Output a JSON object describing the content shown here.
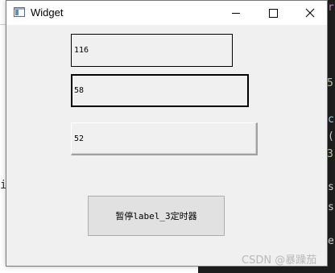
{
  "window": {
    "title": "Widget",
    "icon": "app-window-icon",
    "controls": [
      "minimize-icon",
      "maximize-icon",
      "close-icon"
    ]
  },
  "fields": {
    "label_1": "116",
    "label_2": "58",
    "label_3": "52"
  },
  "pause_button": {
    "label": "暂停label_3定时器"
  },
  "watermark": "CSDN @暴躁茄",
  "background_fragments": {
    "left_char": "i",
    "right_chars": [
      "r",
      "5",
      "c",
      "(",
      "3",
      "s",
      "s",
      "e"
    ]
  },
  "colors": {
    "window_bg": "#f0f0f0",
    "titlebar_bg": "#ffffff",
    "editor_bg": "#1e1e1e"
  }
}
